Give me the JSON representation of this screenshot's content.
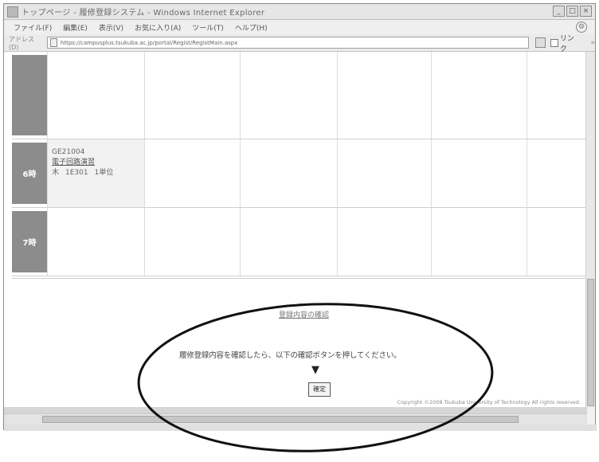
{
  "window": {
    "title": "トップページ - 履修登録システム - Windows Internet Explorer",
    "controls": [
      "_",
      "□",
      "×"
    ]
  },
  "menu": {
    "items": [
      "ファイル(F)",
      "編集(E)",
      "表示(V)",
      "お気に入り(A)",
      "ツール(T)",
      "ヘルプ(H)"
    ]
  },
  "address": {
    "label": "アドレス(D)",
    "url": "https://campusplus.tsukuba.ac.jp/portal/Regist/RegistMain.aspx",
    "link_label": "リンク",
    "more": "»"
  },
  "schedule": {
    "rows": [
      {
        "period": "",
        "course": null
      },
      {
        "period": "6時",
        "course": {
          "code": "GE21004",
          "name": "電子回路演習",
          "day": "木",
          "room": "1E301",
          "credits": "1単位"
        }
      },
      {
        "period": "7時",
        "course": null
      }
    ]
  },
  "confirm": {
    "link_text": "登録内容の確認",
    "instruction": "履修登録内容を確認したら、以下の確認ボタンを押してください。",
    "arrow": "▼",
    "button_label": "確定"
  },
  "footer": {
    "copyright": "Copyright ©2008 Tsukuba University of Technology All rights reserved."
  }
}
